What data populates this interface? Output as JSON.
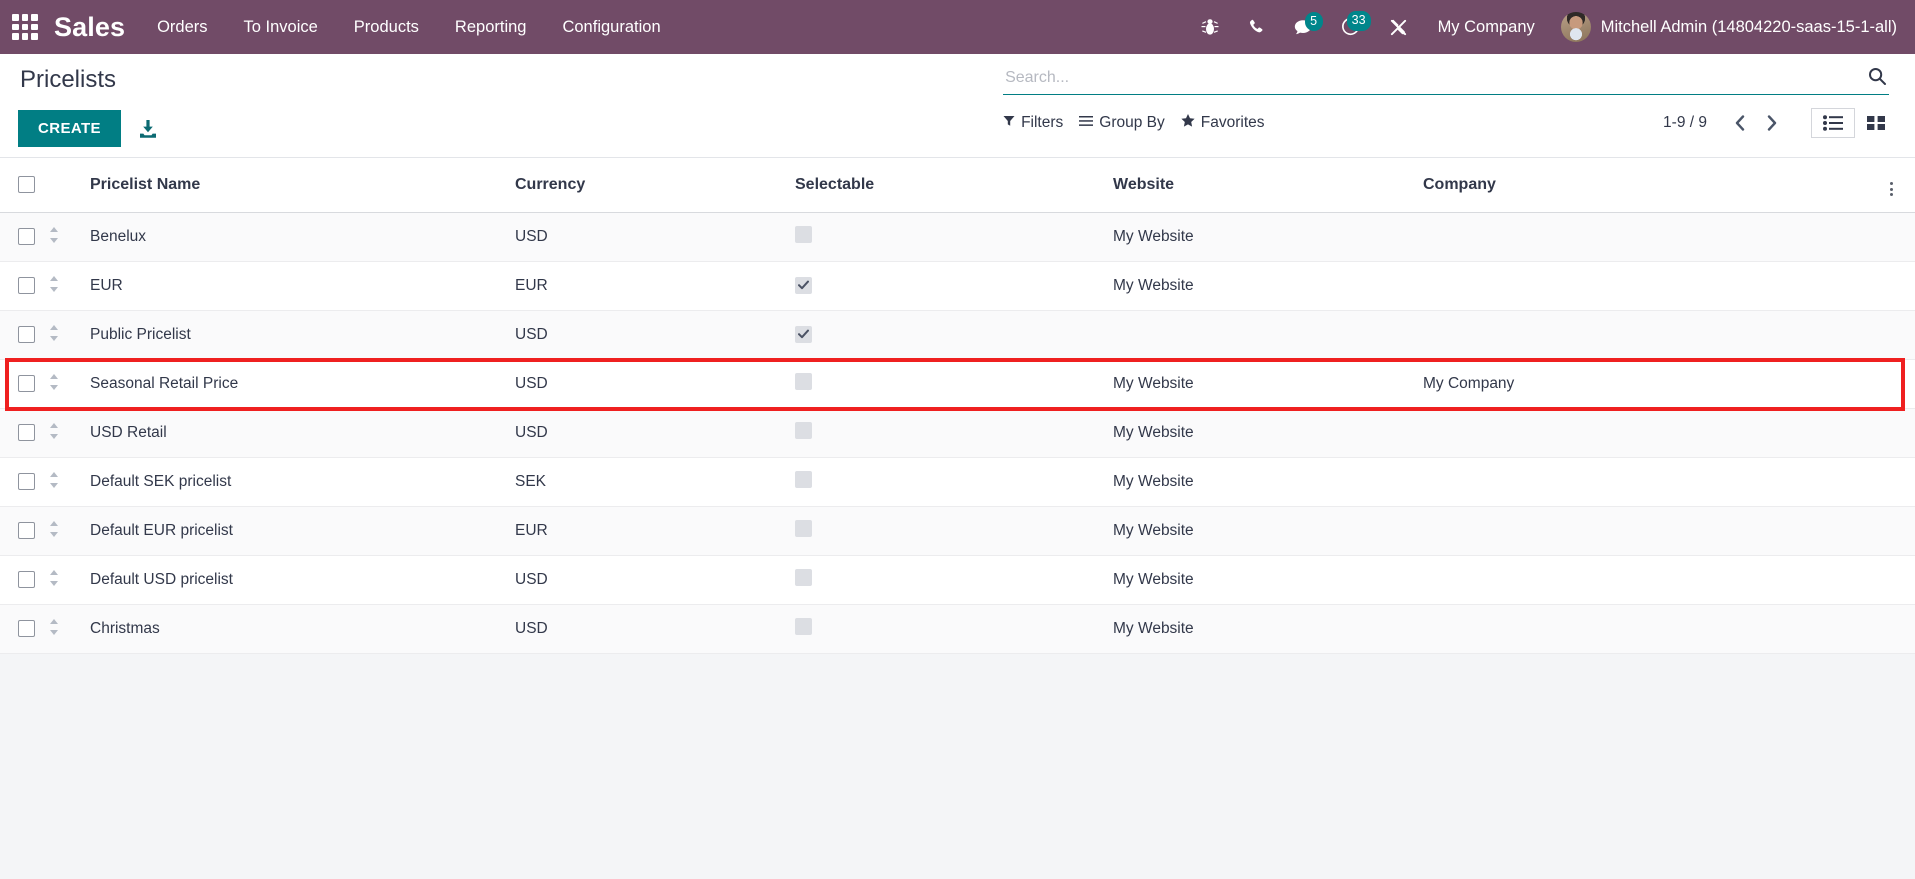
{
  "navbar": {
    "apps_icon": "apps-grid-icon",
    "brand": "Sales",
    "menu": [
      {
        "label": "Orders"
      },
      {
        "label": "To Invoice"
      },
      {
        "label": "Products"
      },
      {
        "label": "Reporting"
      },
      {
        "label": "Configuration"
      }
    ],
    "system_icons": [
      {
        "name": "bug-icon",
        "badge": ""
      },
      {
        "name": "phone-icon",
        "badge": ""
      },
      {
        "name": "chat-icon",
        "badge": "5"
      },
      {
        "name": "activity-clock-icon",
        "badge": "33"
      },
      {
        "name": "tools-icon",
        "badge": ""
      }
    ],
    "company": "My Company",
    "user": "Mitchell Admin (14804220-saas-15-1-all)",
    "background_color": "#714B67",
    "badge_color": "#00868B"
  },
  "control_panel": {
    "title": "Pricelists",
    "create_label": "CREATE",
    "import_icon": "import-download-icon",
    "accent_color": "#017E84",
    "search": {
      "placeholder": "Search...",
      "value": "",
      "search_icon": "search-icon"
    },
    "tools": [
      {
        "label": "Filters",
        "icon": "filter-icon"
      },
      {
        "label": "Group By",
        "icon": "group-by-icon"
      },
      {
        "label": "Favorites",
        "icon": "star-icon"
      }
    ],
    "pager": {
      "range": "1-9 / 9",
      "prev_icon": "chevron-left-icon",
      "next_icon": "chevron-right-icon"
    },
    "views": [
      {
        "name": "list-view",
        "icon": "list-icon",
        "active": true
      },
      {
        "name": "kanban-view",
        "icon": "kanban-icon",
        "active": false
      }
    ]
  },
  "table": {
    "columns": [
      "Pricelist Name",
      "Currency",
      "Selectable",
      "Website",
      "Company"
    ],
    "optional_columns_icon": "vertical-dots-icon",
    "rows": [
      {
        "name": "Benelux",
        "currency": "USD",
        "selectable": false,
        "website": "My Website",
        "company": "",
        "highlighted": false
      },
      {
        "name": "EUR",
        "currency": "EUR",
        "selectable": true,
        "website": "My Website",
        "company": "",
        "highlighted": false
      },
      {
        "name": "Public Pricelist",
        "currency": "USD",
        "selectable": true,
        "website": "",
        "company": "",
        "highlighted": false
      },
      {
        "name": "Seasonal Retail Price",
        "currency": "USD",
        "selectable": false,
        "website": "My Website",
        "company": "My Company",
        "highlighted": true
      },
      {
        "name": "USD Retail",
        "currency": "USD",
        "selectable": false,
        "website": "My Website",
        "company": "",
        "highlighted": false
      },
      {
        "name": "Default SEK pricelist",
        "currency": "SEK",
        "selectable": false,
        "website": "My Website",
        "company": "",
        "highlighted": false
      },
      {
        "name": "Default EUR pricelist",
        "currency": "EUR",
        "selectable": false,
        "website": "My Website",
        "company": "",
        "highlighted": false
      },
      {
        "name": "Default USD pricelist",
        "currency": "USD",
        "selectable": false,
        "website": "My Website",
        "company": "",
        "highlighted": false
      },
      {
        "name": "Christmas",
        "currency": "USD",
        "selectable": false,
        "website": "My Website",
        "company": "",
        "highlighted": false
      }
    ],
    "highlight_color": "#ef2020"
  }
}
